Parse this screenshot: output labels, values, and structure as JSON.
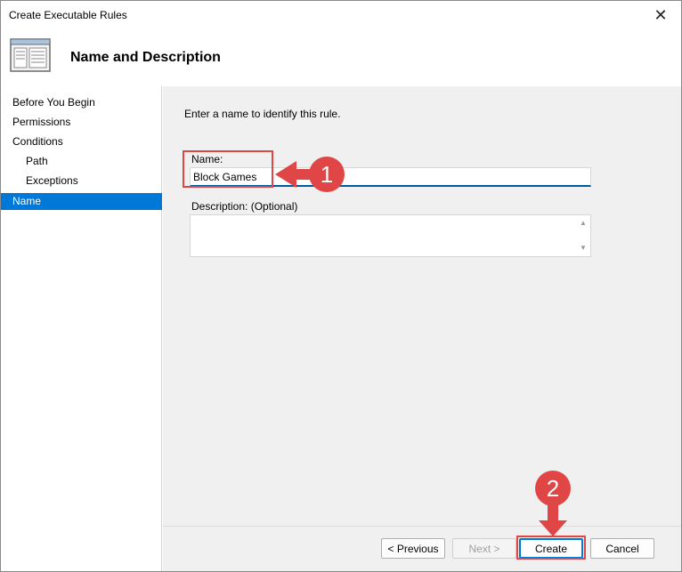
{
  "window": {
    "title": "Create Executable Rules",
    "close_glyph": "✕"
  },
  "header": {
    "title": "Name and Description",
    "icon": "wizard-page-icon"
  },
  "sidebar": {
    "items": [
      {
        "label": "Before You Begin",
        "indent": false,
        "active": false
      },
      {
        "label": "Permissions",
        "indent": false,
        "active": false
      },
      {
        "label": "Conditions",
        "indent": false,
        "active": false
      },
      {
        "label": "Path",
        "indent": true,
        "active": false
      },
      {
        "label": "Exceptions",
        "indent": true,
        "active": false
      },
      {
        "label": "Name",
        "indent": false,
        "active": true
      }
    ]
  },
  "content": {
    "intro": "Enter a name to identify this rule.",
    "name_label": "Name:",
    "name_value": "Block Games",
    "description_label": "Description: (Optional)",
    "description_value": ""
  },
  "footer": {
    "previous_label": "< Previous",
    "next_label": "Next >",
    "create_label": "Create",
    "cancel_label": "Cancel"
  },
  "annotations": {
    "step1": "1",
    "step2": "2",
    "color": "#e04646"
  },
  "colors": {
    "accent": "#0078d7",
    "panel": "#f0f0f0"
  }
}
